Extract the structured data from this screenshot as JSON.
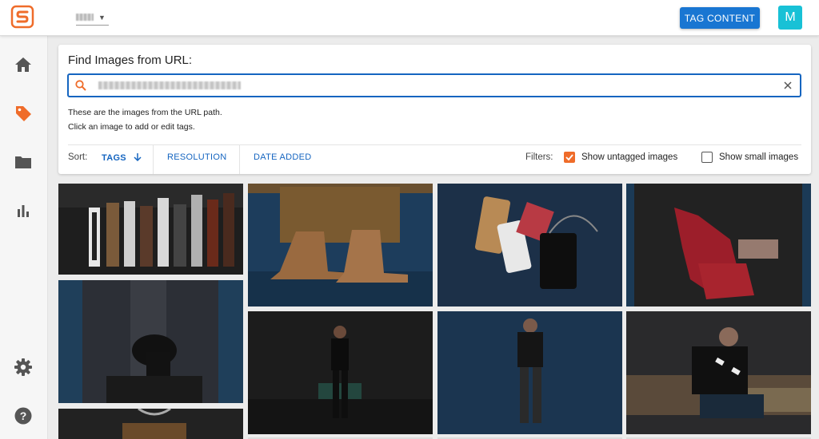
{
  "header": {
    "tag_button_label": "TAG CONTENT",
    "avatar_initial": "M",
    "colors": {
      "accent": "#1976d2",
      "brand": "#ef6c2a",
      "avatar": "#18c1d6"
    }
  },
  "sidebar": {
    "items": [
      {
        "icon": "home-icon"
      },
      {
        "icon": "tag-icon"
      },
      {
        "icon": "folder-icon"
      },
      {
        "icon": "bar-chart-icon"
      },
      {
        "icon": "gear-icon"
      },
      {
        "icon": "help-icon"
      }
    ]
  },
  "finder": {
    "title": "Find Images from URL:",
    "line1": "These are the images from the URL path.",
    "line2": "Click an image to add or edit tags."
  },
  "sort": {
    "label": "Sort:",
    "tags": "TAGS",
    "resolution": "RESOLUTION",
    "date_added": "DATE ADDED"
  },
  "filters": {
    "label": "Filters:",
    "untagged": {
      "label": "Show untagged images",
      "checked": true
    },
    "small": {
      "label": "Show small images",
      "checked": false
    }
  }
}
